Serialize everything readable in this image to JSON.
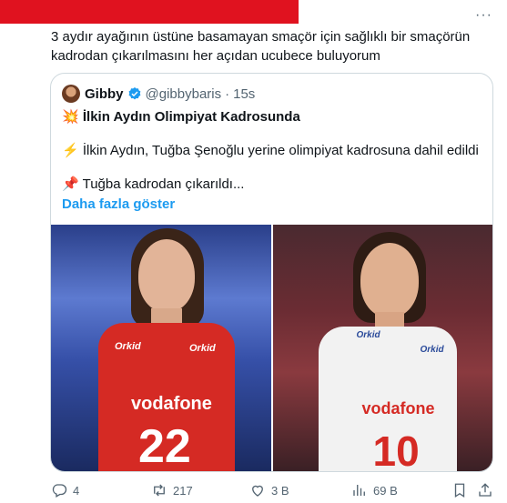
{
  "tweet": {
    "text": "3 aydır ayağının üstüne basamayan smaçör için sağlıklı bir smaçörün kadrodan çıkarılmasını her açıdan ucubece buluyorum",
    "more_icon": "more-dots-icon"
  },
  "quote": {
    "name": "Gibby",
    "handle": "@gibbybaris",
    "separator": "·",
    "time": "15s",
    "title_emoji": "💥",
    "title": "İlkin Aydın Olimpiyat Kadrosunda",
    "line2_emoji": "⚡",
    "line2": "İlkin Aydın, Tuğba Şenoğlu yerine olimpiyat kadrosuna dahil edildi",
    "line3_emoji": "📌",
    "line3": "Tuğba kadrodan çıkarıldı...",
    "show_more": "Daha fazla göster",
    "photo1": {
      "jersey_brand": "Orkid",
      "sponsor": "vodafone",
      "number": "22"
    },
    "photo2": {
      "jersey_brand": "Orkid",
      "sponsor": "vodafone",
      "number": "10"
    }
  },
  "actions": {
    "replies": "4",
    "retweets": "217",
    "likes": "3 B",
    "views": "69 B"
  },
  "colors": {
    "accent": "#1d9bf0",
    "red_bar": "#e0121f"
  }
}
